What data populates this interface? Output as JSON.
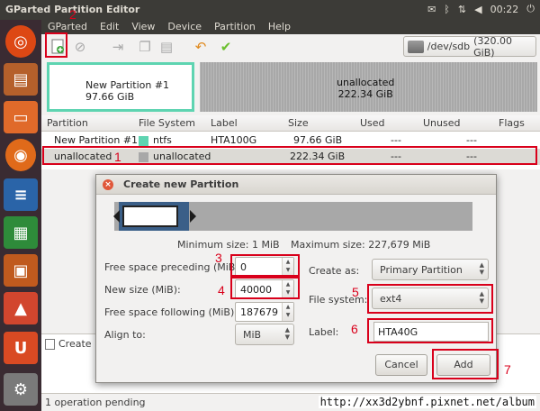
{
  "window": {
    "title": "GParted Partition Editor"
  },
  "tray": {
    "time": "00:22"
  },
  "menu": [
    "GParted",
    "Edit",
    "View",
    "Device",
    "Partition",
    "Help"
  ],
  "toolbar": {
    "device": "/dev/sdb",
    "device_size": "(320.00 GiB)"
  },
  "map": {
    "partition1": {
      "name": "New Partition #1",
      "size": "97.66 GiB"
    },
    "unallocated": {
      "name": "unallocated",
      "size": "222.34 GiB"
    }
  },
  "table": {
    "headers": [
      "Partition",
      "File System",
      "Label",
      "Size",
      "Used",
      "Unused",
      "Flags"
    ],
    "rows": [
      {
        "partition": "New Partition #1",
        "fs": "ntfs",
        "label": "HTA100G",
        "size": "97.66 GiB",
        "used": "---",
        "unused": "---",
        "flags": "",
        "fs_color": "#5ed4b1"
      },
      {
        "partition": "unallocated",
        "fs": "unallocated",
        "label": "",
        "size": "222.34 GiB",
        "used": "---",
        "unused": "---",
        "flags": "",
        "fs_color": "#a8a8a8"
      }
    ]
  },
  "ops": {
    "item": "Create I"
  },
  "status": {
    "text": "1 operation pending"
  },
  "watermark": "http://xx3d2ybnf.pixnet.net/album",
  "dialog": {
    "title": "Create new Partition",
    "min_size": "Minimum size: 1 MiB",
    "max_size": "Maximum size: 227,679 MiB",
    "free_before_label": "Free space preceding (MiB):",
    "free_before": "0",
    "new_size_label": "New size (MiB):",
    "new_size": "40000",
    "free_after_label": "Free space following (MiB):",
    "free_after": "187679",
    "align_label": "Align to:",
    "align": "MiB",
    "create_as_label": "Create as:",
    "create_as": "Primary Partition",
    "fs_label": "File system:",
    "fs": "ext4",
    "label_label": "Label:",
    "label": "HTA40G",
    "cancel": "Cancel",
    "add": "Add"
  },
  "annotations": [
    "1",
    "2",
    "3",
    "4",
    "5",
    "6",
    "7"
  ],
  "colors": {
    "accent": "#d9001b",
    "ntfs": "#5ed4b1",
    "unallocated": "#a8a8a8",
    "resize_partition": "#3b5f88"
  }
}
